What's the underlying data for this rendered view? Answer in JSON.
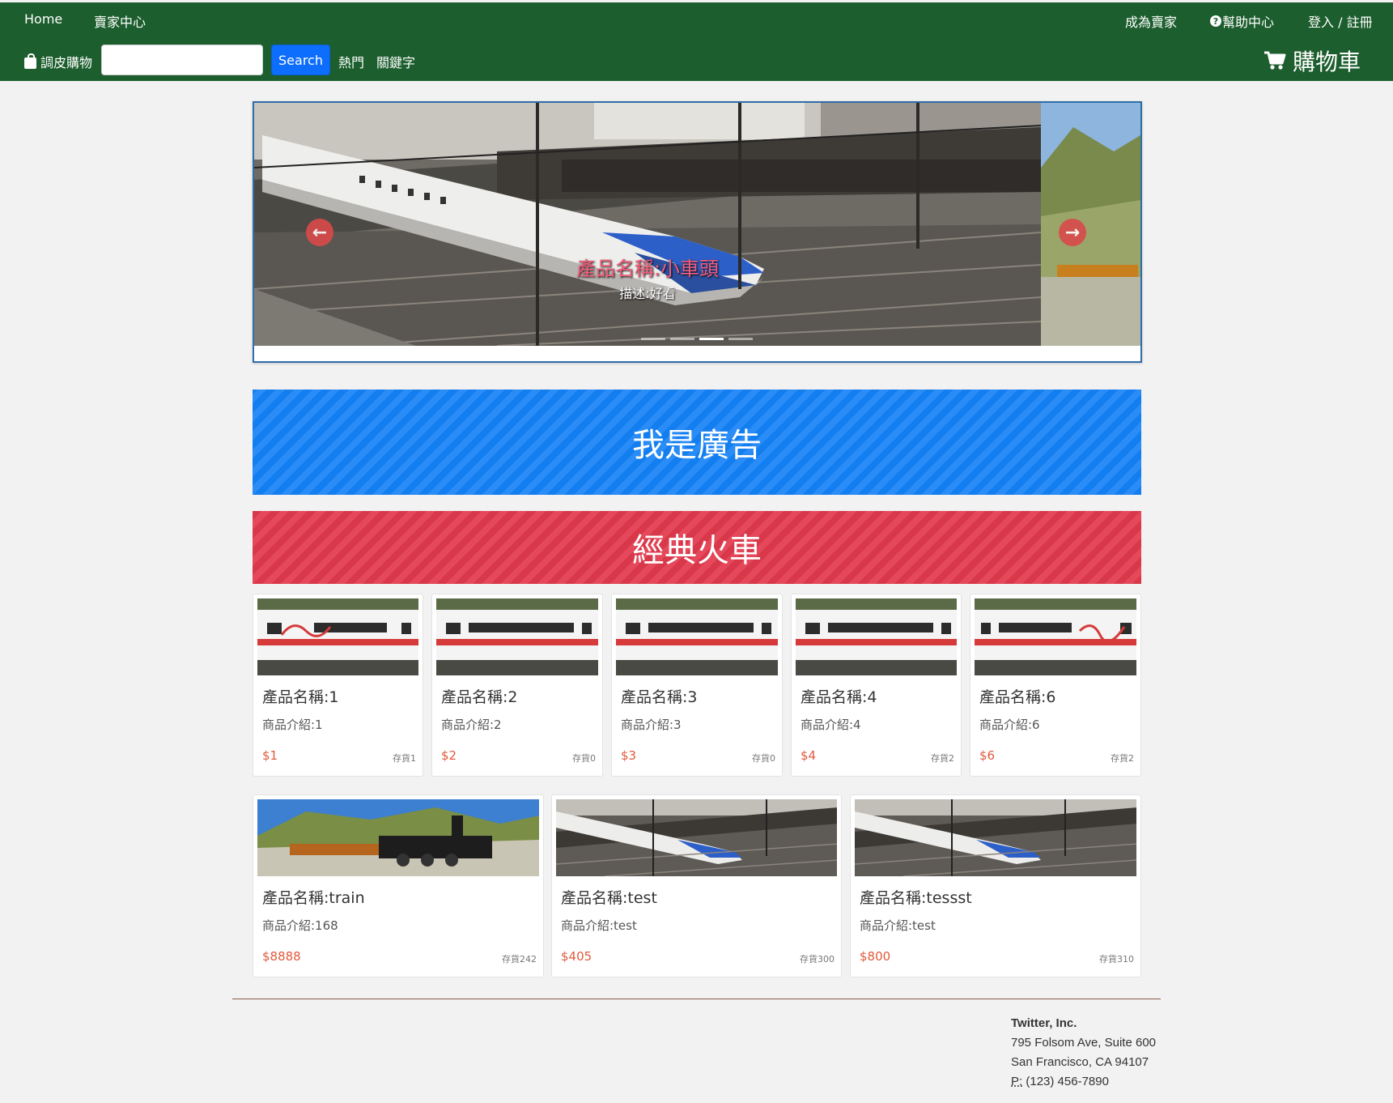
{
  "nav": {
    "home": "Home",
    "seller_center": "賣家中心",
    "become_seller": "成為賣家",
    "help": "幫助中心",
    "login": "登入 / 註冊",
    "brand": "調皮購物",
    "search_button": "Search",
    "search_value": "",
    "hot": "熱門",
    "keywords": "關鍵字",
    "cart": "購物車"
  },
  "carousel": {
    "caption_title": "產品名稱:小車頭",
    "caption_desc": "描述:好看",
    "slide_count": 4,
    "active_index": 2
  },
  "banners": {
    "ad": "我是廣告",
    "category": "經典火車"
  },
  "products_row1": [
    {
      "name": "產品名稱:1",
      "desc": "商品介紹:1",
      "price": "$1",
      "stock": "存貨1"
    },
    {
      "name": "產品名稱:2",
      "desc": "商品介紹:2",
      "price": "$2",
      "stock": "存貨0"
    },
    {
      "name": "產品名稱:3",
      "desc": "商品介紹:3",
      "price": "$3",
      "stock": "存貨0"
    },
    {
      "name": "產品名稱:4",
      "desc": "商品介紹:4",
      "price": "$4",
      "stock": "存貨2"
    },
    {
      "name": "產品名稱:6",
      "desc": "商品介紹:6",
      "price": "$6",
      "stock": "存貨2"
    }
  ],
  "products_row2": [
    {
      "name": "產品名稱:train",
      "desc": "商品介紹:168",
      "price": "$8888",
      "stock": "存貨242"
    },
    {
      "name": "產品名稱:test",
      "desc": "商品介紹:test",
      "price": "$405",
      "stock": "存貨300"
    },
    {
      "name": "產品名稱:tessst",
      "desc": "商品介紹:test",
      "price": "$800",
      "stock": "存貨310"
    }
  ],
  "footer": {
    "company": "Twitter, Inc.",
    "address1": "795 Folsom Ave, Suite 600",
    "address2": "San Francisco, CA 94107",
    "phone_label": "P:",
    "phone": "(123) 456-7890"
  },
  "colors": {
    "nav_bg": "#1c5e2e",
    "search_button": "#0d6efd",
    "ad_banner": "#137ef0",
    "category_banner": "#d9374a",
    "price": "#e05a3c"
  }
}
